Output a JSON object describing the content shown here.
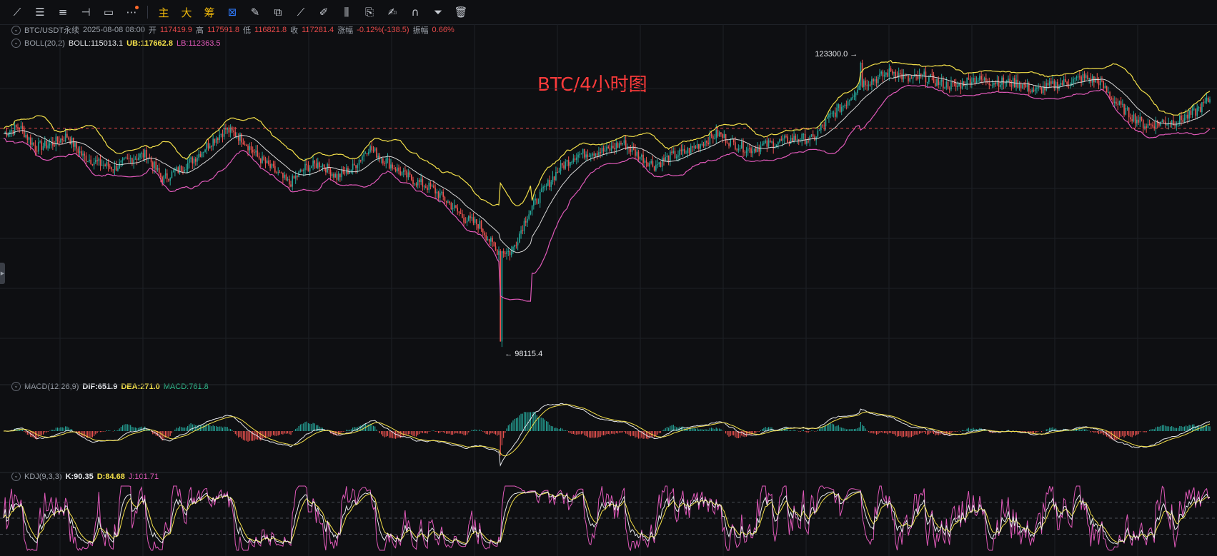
{
  "toolbar": {
    "items": [
      {
        "name": "trendline-icon",
        "glyph": "⟋"
      },
      {
        "name": "parallel-lines-icon",
        "glyph": "☰"
      },
      {
        "name": "fib-lines-icon",
        "glyph": "≡"
      },
      {
        "name": "horizontal-ray-icon",
        "glyph": "⊣"
      },
      {
        "name": "rectangle-icon",
        "glyph": "▭"
      },
      {
        "name": "more-icon",
        "glyph": "⋯"
      }
    ],
    "cn_buttons": [
      "主",
      "大",
      "筹"
    ],
    "right_items": [
      {
        "name": "measure-icon",
        "glyph": "⊠"
      },
      {
        "name": "pen-icon",
        "glyph": "✎"
      },
      {
        "name": "copy-icon",
        "glyph": "⧉"
      },
      {
        "name": "ruler-icon",
        "glyph": "⟋"
      },
      {
        "name": "brush-icon",
        "glyph": "✐"
      },
      {
        "name": "candles-icon",
        "glyph": "⫼"
      },
      {
        "name": "clipboard-icon",
        "glyph": "⎘"
      },
      {
        "name": "note-icon",
        "glyph": "✍"
      },
      {
        "name": "magnet-icon",
        "glyph": "∩"
      },
      {
        "name": "filter-icon",
        "glyph": "⏷"
      },
      {
        "name": "trash-icon",
        "glyph": "🗑"
      }
    ]
  },
  "legend_main": {
    "symbol": "BTC/USDT永续",
    "datetime": "2025-08-08 08:00",
    "open_label": "开",
    "open": "117419.9",
    "high_label": "高",
    "high": "117591.8",
    "low_label": "低",
    "low": "116821.8",
    "close_label": "收",
    "close": "117281.4",
    "change_label": "涨幅",
    "change": "-0.12%(-138.5)",
    "amp_label": "振幅",
    "amp": "0.66%"
  },
  "legend_boll": {
    "name": "BOLL(20,2)",
    "mid": "BOLL:115013.1",
    "ub": "UB:117662.8",
    "lb": "LB:112363.5"
  },
  "legend_macd": {
    "name": "MACD(12,26,9)",
    "dif": "DIF:651.9",
    "dea": "DEA:271.0",
    "macd": "MACD:761.8"
  },
  "legend_kdj": {
    "name": "KDJ(9,3,3)",
    "k": "K:90.35",
    "d": "D:84.68",
    "j": "J:101.71"
  },
  "overlay_title": "BTC/4小时图",
  "colors": {
    "up": "#26a69a",
    "down": "#ef5350",
    "boll_mid": "#d8d8d8",
    "boll_ub": "#f4e04a",
    "boll_lb": "#e059b9",
    "grid": "#1d2026",
    "ref_line": "#e84a4a"
  },
  "chart_data": {
    "type": "candlestick",
    "series_main": {
      "note_points": [
        {
          "label": "123300.0",
          "kind": "high"
        },
        {
          "label": "98115.4",
          "kind": "low"
        }
      ],
      "close_path": [
        [
          0,
          116800
        ],
        [
          10,
          117400
        ],
        [
          20,
          115600
        ],
        [
          30,
          115900
        ],
        [
          40,
          116600
        ],
        [
          50,
          114800
        ],
        [
          60,
          114200
        ],
        [
          70,
          113800
        ],
        [
          80,
          114600
        ],
        [
          90,
          115000
        ],
        [
          100,
          112800
        ],
        [
          110,
          113600
        ],
        [
          120,
          114600
        ],
        [
          130,
          116000
        ],
        [
          140,
          117200
        ],
        [
          150,
          116400
        ],
        [
          160,
          114800
        ],
        [
          170,
          113600
        ],
        [
          180,
          112400
        ],
        [
          190,
          113800
        ],
        [
          200,
          114200
        ],
        [
          210,
          113000
        ],
        [
          220,
          113800
        ],
        [
          230,
          115600
        ],
        [
          240,
          114500
        ],
        [
          250,
          113400
        ],
        [
          260,
          112600
        ],
        [
          270,
          112000
        ],
        [
          280,
          110800
        ],
        [
          290,
          109400
        ],
        [
          300,
          108800
        ],
        [
          310,
          106600
        ],
        [
          320,
          106400
        ],
        [
          330,
          109700
        ],
        [
          340,
          111800
        ],
        [
          350,
          113700
        ],
        [
          360,
          114900
        ],
        [
          370,
          115200
        ],
        [
          380,
          115300
        ],
        [
          390,
          116000
        ],
        [
          400,
          114900
        ],
        [
          410,
          114000
        ],
        [
          420,
          114800
        ],
        [
          430,
          115200
        ],
        [
          440,
          116000
        ],
        [
          450,
          116800
        ],
        [
          460,
          115900
        ],
        [
          470,
          115400
        ],
        [
          480,
          115800
        ],
        [
          490,
          116100
        ],
        [
          500,
          116400
        ],
        [
          510,
          116300
        ],
        [
          520,
          118200
        ],
        [
          530,
          119400
        ],
        [
          540,
          121200
        ],
        [
          550,
          121600
        ],
        [
          560,
          122300
        ],
        [
          570,
          121500
        ],
        [
          580,
          121800
        ],
        [
          590,
          121200
        ],
        [
          600,
          120900
        ],
        [
          610,
          121600
        ],
        [
          620,
          121400
        ],
        [
          630,
          121300
        ],
        [
          640,
          121200
        ],
        [
          650,
          120500
        ],
        [
          660,
          121000
        ],
        [
          670,
          121300
        ],
        [
          680,
          121700
        ],
        [
          690,
          121400
        ],
        [
          700,
          119600
        ],
        [
          710,
          118400
        ],
        [
          720,
          117500
        ],
        [
          730,
          117800
        ],
        [
          740,
          117900
        ],
        [
          750,
          118600
        ],
        [
          760,
          119800
        ]
      ]
    },
    "price_ref_line": "117281.4"
  }
}
